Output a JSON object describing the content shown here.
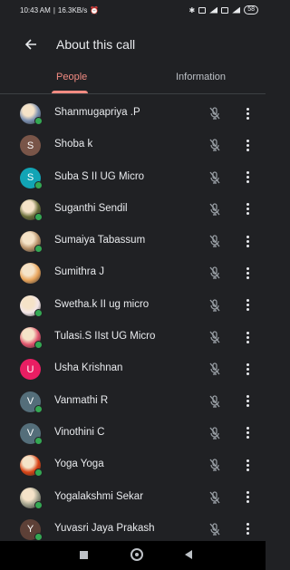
{
  "status": {
    "time": "10:43 AM",
    "speed": "16.3KB/s",
    "battery": "58"
  },
  "appbar": {
    "title": "About this call"
  },
  "tabs": {
    "people": "People",
    "information": "Information"
  },
  "colors": {
    "accent": "#f28b82",
    "online": "#34a853",
    "background": "#202124"
  },
  "participants": [
    {
      "name": "Shanmugapriya .P",
      "avatar": "photo",
      "avatar_color": "#7a8fb0",
      "initial": "",
      "online": true
    },
    {
      "name": "Shoba k",
      "avatar": "letter",
      "avatar_color": "#795548",
      "initial": "S",
      "online": false
    },
    {
      "name": "Suba S II UG Micro",
      "avatar": "letter",
      "avatar_color": "#12a4b5",
      "initial": "S",
      "online": true
    },
    {
      "name": "Suganthi Sendil",
      "avatar": "photo",
      "avatar_color": "#6b6f3a",
      "initial": "",
      "online": true
    },
    {
      "name": "Sumaiya Tabassum",
      "avatar": "photo",
      "avatar_color": "#b8926a",
      "initial": "",
      "online": true
    },
    {
      "name": "Sumithra J",
      "avatar": "photo",
      "avatar_color": "#e9a55c",
      "initial": "",
      "online": false
    },
    {
      "name": "Swetha.k II ug micro",
      "avatar": "photo",
      "avatar_color": "#f3e6e8",
      "initial": "",
      "online": true
    },
    {
      "name": "Tulasi.S IIst UG Micro",
      "avatar": "photo",
      "avatar_color": "#e0556e",
      "initial": "",
      "online": true
    },
    {
      "name": "Usha Krishnan",
      "avatar": "letter",
      "avatar_color": "#e91e63",
      "initial": "U",
      "online": false
    },
    {
      "name": "Vanmathi R",
      "avatar": "letter",
      "avatar_color": "#546e7a",
      "initial": "V",
      "online": true
    },
    {
      "name": "Vinothini C",
      "avatar": "letter",
      "avatar_color": "#546e7a",
      "initial": "V",
      "online": true
    },
    {
      "name": "Yoga Yoga",
      "avatar": "photo",
      "avatar_color": "#d84315",
      "initial": "",
      "online": true
    },
    {
      "name": "Yogalakshmi Sekar",
      "avatar": "photo",
      "avatar_color": "#9e9e8a",
      "initial": "",
      "online": true
    },
    {
      "name": "Yuvasri Jaya Prakash",
      "avatar": "letter",
      "avatar_color": "#5d4037",
      "initial": "Y",
      "online": true
    }
  ],
  "icons": {
    "mic": "mic-off-icon",
    "more": "more-vert-icon"
  }
}
